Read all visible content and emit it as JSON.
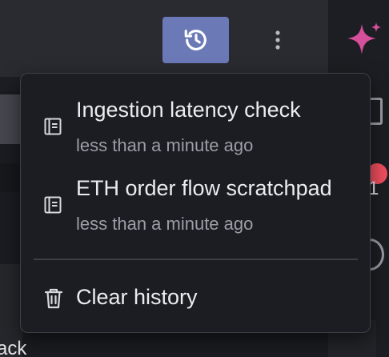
{
  "toolbar": {
    "history_button_icon": "history-icon",
    "more_button_icon": "more-vertical-icon",
    "accent_color": "#6b79b7"
  },
  "right_rail": {
    "sparkle_icon": "sparkle-icon",
    "sparkle_color": "#d64f9a",
    "badge_color": "#ef4f5f",
    "digit": "1"
  },
  "background": {
    "partial_text": "ack"
  },
  "history_menu": {
    "items": [
      {
        "title": "Ingestion latency check",
        "subtitle": "less than a minute ago",
        "icon": "notebook-icon"
      },
      {
        "title": "ETH order flow scratchpad",
        "subtitle": "less than a minute ago",
        "icon": "notebook-icon"
      }
    ],
    "clear": {
      "label": "Clear history",
      "icon": "trash-icon"
    }
  }
}
